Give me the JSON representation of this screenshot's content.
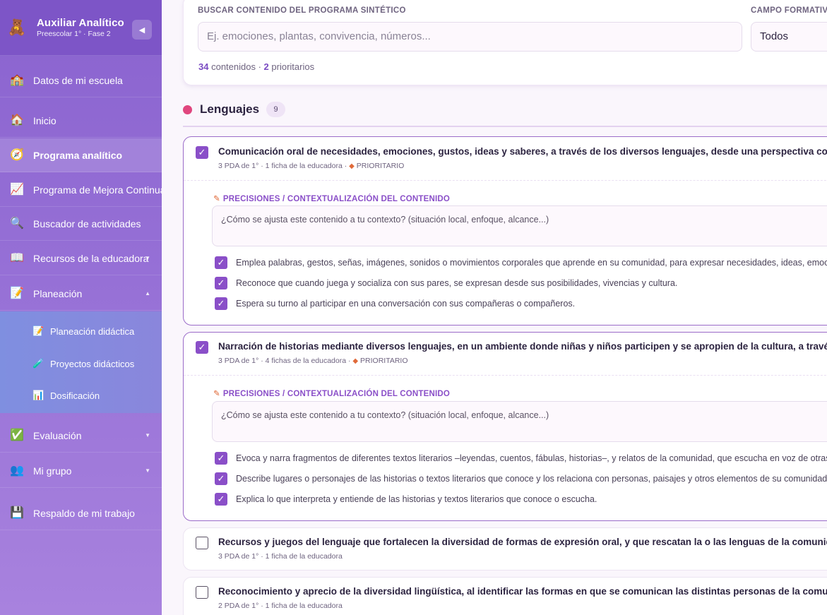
{
  "sidebar": {
    "app_title": "Auxiliar Analítico",
    "app_subtitle": "Preescolar 1° · Fase 2",
    "logo_icon": "teddy-bear",
    "collapse_icon": "◀",
    "items": [
      {
        "label": "Datos de mi escuela",
        "icon": "🏫"
      },
      {
        "label": "Inicio",
        "icon": "🏠"
      },
      {
        "label": "Programa analítico",
        "icon": "🧭"
      },
      {
        "label": "Programa de Mejora Continua",
        "icon": "📈"
      },
      {
        "label": "Buscador de actividades",
        "icon": "🔍"
      },
      {
        "label": "Recursos de la educadora",
        "icon": "📖"
      },
      {
        "label": "Planeación",
        "icon": "📝"
      },
      {
        "label": "Evaluación",
        "icon": "✅"
      },
      {
        "label": "Mi grupo",
        "icon": "👥"
      },
      {
        "label": "Respaldo de mi trabajo",
        "icon": "💾"
      }
    ],
    "sub_items": [
      {
        "label": "Planeación didáctica",
        "icon": "📝"
      },
      {
        "label": "Proyectos didácticos",
        "icon": "🧪"
      },
      {
        "label": "Dosificación",
        "icon": "📊"
      }
    ]
  },
  "filters": {
    "search_label": "BUSCAR CONTENIDO DEL PROGRAMA SINTÉTICO",
    "search_placeholder": "Ej. emociones, plantas, convivencia, números...",
    "campo_label": "CAMPO FORMATIVO",
    "campo_value": "Todos",
    "count_total": "34",
    "count_total_text": "contenidos ·",
    "count_priority": "2",
    "count_priority_text": "prioritarios"
  },
  "section": {
    "title": "Lenguajes",
    "count": "9",
    "dot_color": "#e0467e"
  },
  "precision_label": "PRECISIONES / CONTEXTUALIZACIÓN DEL CONTENIDO",
  "precision_placeholder": "¿Cómo se ajusta este contenido a tu contexto? (situación local, enfoque, alcance...)",
  "cards": [
    {
      "title": "Comunicación oral de necesidades, emociones, gustos, ideas y saberes, a través de los diversos lenguajes, desde una perspectiva comunitaria.",
      "meta": "3 PDA de 1° · 1 ficha de la educadora ·",
      "priority": "PRIORITARIO",
      "checked": true,
      "pdas": [
        "Emplea palabras, gestos, señas, imágenes, sonidos o movimientos corporales que aprende en su comunidad, para expresar necesidades, ideas, emociones y gustos.",
        "Reconoce que cuando juega y socializa con sus pares, se expresan desde sus posibilidades, vivencias y cultura.",
        "Espera su turno al participar en una conversación con sus compañeras o compañeros."
      ]
    },
    {
      "title": "Narración de historias mediante diversos lenguajes, en un ambiente donde niñas y niños participen y se apropien de la cultura, a través de la lectura.",
      "meta": "3 PDA de 1° · 4 fichas de la educadora ·",
      "priority": "PRIORITARIO",
      "checked": true,
      "pdas": [
        "Evoca y narra fragmentos de diferentes textos literarios –leyendas, cuentos, fábulas, historias–, y relatos de la comunidad, que escucha en voz de otras personas.",
        "Describe lugares o personajes de las historias o textos literarios que conoce y los relaciona con personas, paisajes y otros elementos de su comunidad.",
        "Explica lo que interpreta y entiende de las historias y textos literarios que conoce o escucha."
      ]
    },
    {
      "title": "Recursos y juegos del lenguaje que fortalecen la diversidad de formas de expresión oral, y que rescatan la o las lenguas de la comunidad y de otros lugares.",
      "meta": "3 PDA de 1° · 1 ficha de la educadora",
      "checked": false
    },
    {
      "title": "Reconocimiento y aprecio de la diversidad lingüística, al identificar las formas en que se comunican las distintas personas de la comunidad.",
      "meta": "2 PDA de 1° · 1 ficha de la educadora",
      "checked": false
    }
  ],
  "colors": {
    "sidebar": "#8a63cf",
    "accent": "#8a4fc8",
    "priority": "#e06a3a"
  }
}
